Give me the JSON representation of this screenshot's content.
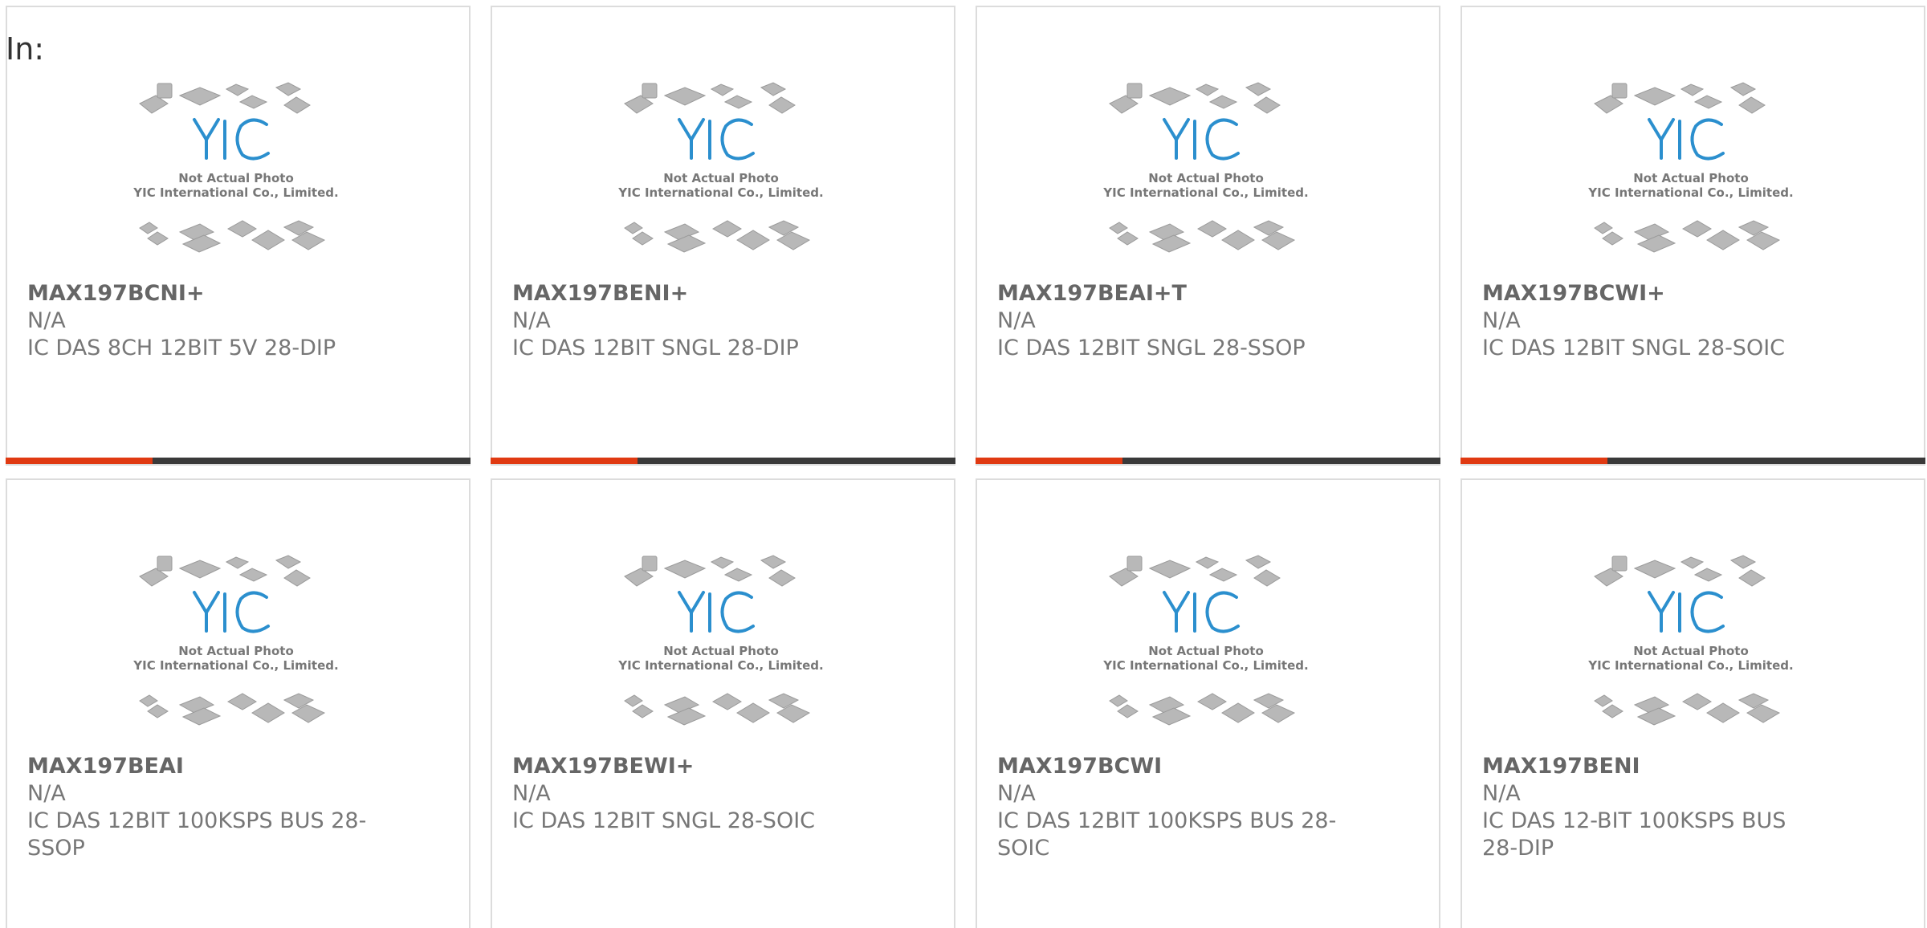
{
  "header": {
    "in_label": "In:"
  },
  "placeholder": {
    "line1": "Not Actual Photo",
    "line2": "YIC International Co., Limited.",
    "logo_text": "YIC"
  },
  "colors": {
    "accent": "#e03a12",
    "bar": "#3a3a3a",
    "logo": "#2b8fce",
    "text": "#777777"
  },
  "products": [
    {
      "part": "MAX197BCNI+",
      "mfr": "N/A",
      "desc": "IC DAS 8CH 12BIT 5V 28-DIP"
    },
    {
      "part": "MAX197BENI+",
      "mfr": "N/A",
      "desc": "IC DAS 12BIT SNGL 28-DIP"
    },
    {
      "part": "MAX197BEAI+T",
      "mfr": "N/A",
      "desc": "IC DAS 12BIT SNGL 28-SSOP"
    },
    {
      "part": "MAX197BCWI+",
      "mfr": "N/A",
      "desc": "IC DAS 12BIT SNGL 28-SOIC"
    },
    {
      "part": "MAX197BEAI",
      "mfr": "N/A",
      "desc": "IC DAS 12BIT 100KSPS BUS 28-SSOP"
    },
    {
      "part": "MAX197BEWI+",
      "mfr": "N/A",
      "desc": "IC DAS 12BIT SNGL 28-SOIC"
    },
    {
      "part": "MAX197BCWI",
      "mfr": "N/A",
      "desc": "IC DAS 12BIT 100KSPS BUS 28-SOIC"
    },
    {
      "part": "MAX197BENI",
      "mfr": "N/A",
      "desc": "IC DAS 12-BIT 100KSPS BUS 28-DIP"
    }
  ]
}
